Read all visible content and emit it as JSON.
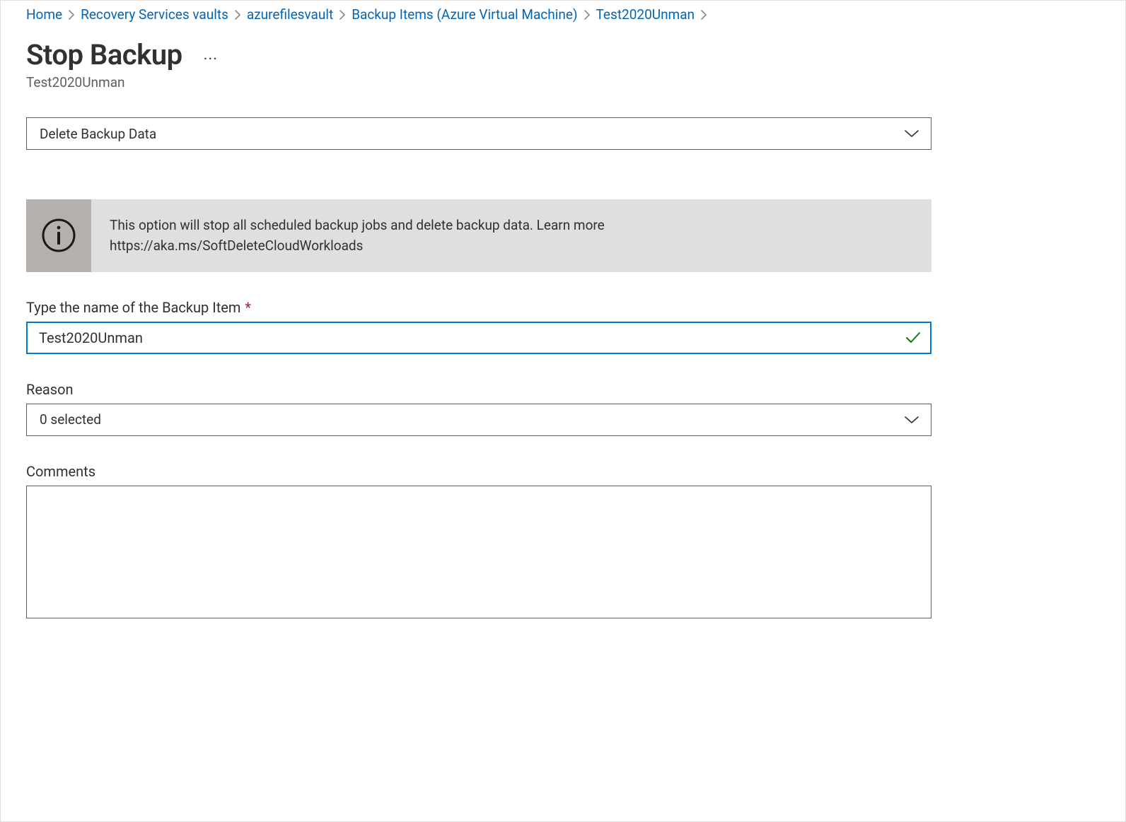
{
  "breadcrumb": {
    "items": [
      {
        "label": "Home"
      },
      {
        "label": "Recovery Services vaults"
      },
      {
        "label": "azurefilesvault"
      },
      {
        "label": "Backup Items (Azure Virtual Machine)"
      },
      {
        "label": "Test2020Unman"
      }
    ]
  },
  "header": {
    "title": "Stop Backup",
    "subtitle": "Test2020Unman"
  },
  "action_select": {
    "value": "Delete Backup Data"
  },
  "info_banner": {
    "line1": "This option will stop all scheduled backup jobs and delete backup data. Learn more",
    "line2": "https://aka.ms/SoftDeleteCloudWorkloads"
  },
  "name_field": {
    "label": "Type the name of the Backup Item",
    "value": "Test2020Unman"
  },
  "reason_field": {
    "label": "Reason",
    "value": "0 selected"
  },
  "comments_field": {
    "label": "Comments",
    "value": ""
  }
}
